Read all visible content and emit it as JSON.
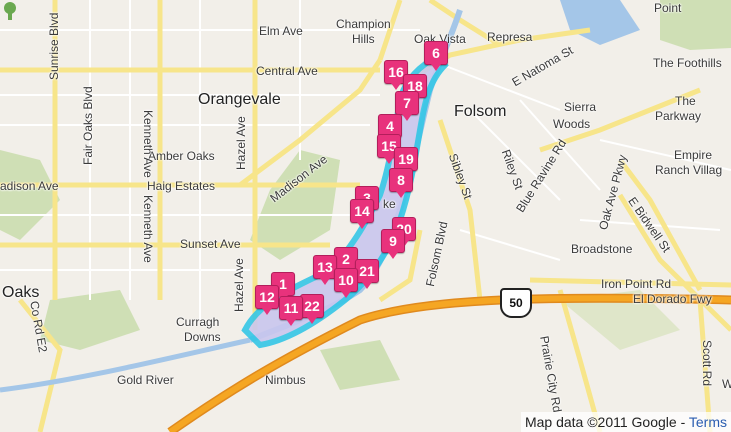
{
  "map": {
    "places": [
      {
        "key": "champion-hills-1",
        "text": "Champion"
      },
      {
        "key": "champion-hills-2",
        "text": "Hills"
      },
      {
        "key": "oak-vista",
        "text": "Oak Vista"
      },
      {
        "key": "represa",
        "text": "Represa"
      },
      {
        "key": "point",
        "text": "Point"
      },
      {
        "key": "orangevale",
        "text": "Orangevale"
      },
      {
        "key": "folsom",
        "text": "Folsom"
      },
      {
        "key": "amber-oaks",
        "text": "Amber Oaks"
      },
      {
        "key": "haig-estates",
        "text": "Haig Estates"
      },
      {
        "key": "sierra-woods-1",
        "text": "Sierra"
      },
      {
        "key": "sierra-woods-2",
        "text": "Woods"
      },
      {
        "key": "the-foothills",
        "text": "The Foothills"
      },
      {
        "key": "the-parkway-1",
        "text": "The"
      },
      {
        "key": "the-parkway-2",
        "text": "Parkway"
      },
      {
        "key": "empire-ranch-1",
        "text": "Empire"
      },
      {
        "key": "empire-ranch-2",
        "text": "Ranch Villag"
      },
      {
        "key": "broadstone",
        "text": "Broadstone"
      },
      {
        "key": "oaks",
        "text": "Oaks"
      },
      {
        "key": "curragh-1",
        "text": "Curragh"
      },
      {
        "key": "curragh-2",
        "text": "Downs"
      },
      {
        "key": "gold-river",
        "text": "Gold River"
      },
      {
        "key": "nimbus",
        "text": "Nimbus"
      },
      {
        "key": "lake",
        "text": "ke"
      }
    ],
    "roads": [
      {
        "key": "elm-ave",
        "text": "Elm Ave"
      },
      {
        "key": "central-ave",
        "text": "Central Ave"
      },
      {
        "key": "madison-ave-left",
        "text": "adison Ave"
      },
      {
        "key": "madison-ave-diag",
        "text": "Madison Ave"
      },
      {
        "key": "sunset-ave",
        "text": "Sunset Ave"
      },
      {
        "key": "sunrise-blvd",
        "text": "Sunrise Blvd"
      },
      {
        "key": "fair-oaks-blvd",
        "text": "Fair Oaks Blvd"
      },
      {
        "key": "kenneth-ave-1",
        "text": "Kenneth Ave"
      },
      {
        "key": "kenneth-ave-2",
        "text": "Kenneth Ave"
      },
      {
        "key": "hazel-ave-1",
        "text": "Hazel Ave"
      },
      {
        "key": "hazel-ave-2",
        "text": "Hazel Ave"
      },
      {
        "key": "co-rd-e2",
        "text": "Co Rd E2"
      },
      {
        "key": "natoma-st",
        "text": "E Natoma St"
      },
      {
        "key": "folsom-blvd",
        "text": "Folsom Blvd"
      },
      {
        "key": "sibley-st",
        "text": "Sibley St"
      },
      {
        "key": "riley-st",
        "text": "Riley St"
      },
      {
        "key": "blue-ravine",
        "text": "Blue Ravine Rd"
      },
      {
        "key": "oak-ave-pkwy",
        "text": "Oak Ave Pkwy"
      },
      {
        "key": "bidwell",
        "text": "E Bidwell St"
      },
      {
        "key": "iron-point",
        "text": "Iron Point Rd"
      },
      {
        "key": "el-dorado-fwy",
        "text": "El Dorado Fwy"
      },
      {
        "key": "prairie-city",
        "text": "Prairie City Rd"
      },
      {
        "key": "scott-rd",
        "text": "Scott Rd"
      },
      {
        "key": "w-label",
        "text": "W"
      }
    ],
    "shield": "50",
    "markers": [
      "6",
      "16",
      "18",
      "7",
      "4",
      "15",
      "19",
      "8",
      "3",
      "14",
      "20",
      "9",
      "2",
      "13",
      "21",
      "10",
      "1",
      "12",
      "22",
      "11"
    ],
    "credit": {
      "text": "Map data ©2011 Google - ",
      "link": "Terms"
    },
    "colors": {
      "marker": "#e8327c",
      "water": "#a4c6e8",
      "highlight": "#35c6e6",
      "highway": "#f5a623",
      "major_road": "#f7e58a",
      "park": "#cfdfb5"
    }
  }
}
